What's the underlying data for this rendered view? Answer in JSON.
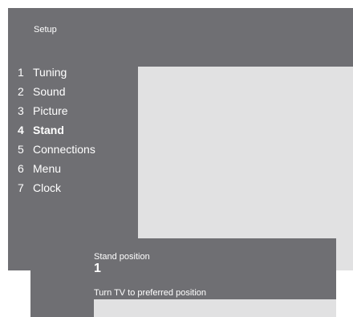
{
  "setup": {
    "title": "Setup",
    "items": [
      {
        "number": "1",
        "label": "Tuning"
      },
      {
        "number": "2",
        "label": "Sound"
      },
      {
        "number": "3",
        "label": "Picture"
      },
      {
        "number": "4",
        "label": "Stand"
      },
      {
        "number": "5",
        "label": "Connections"
      },
      {
        "number": "6",
        "label": "Menu"
      },
      {
        "number": "7",
        "label": "Clock"
      }
    ],
    "selected_index": 3
  },
  "stand": {
    "label": "Stand position",
    "value": "1",
    "instruction": "Turn TV to preferred position"
  },
  "colors": {
    "panel": "#6f6f73",
    "content": "#e1e1e2",
    "text": "#ffffff"
  }
}
